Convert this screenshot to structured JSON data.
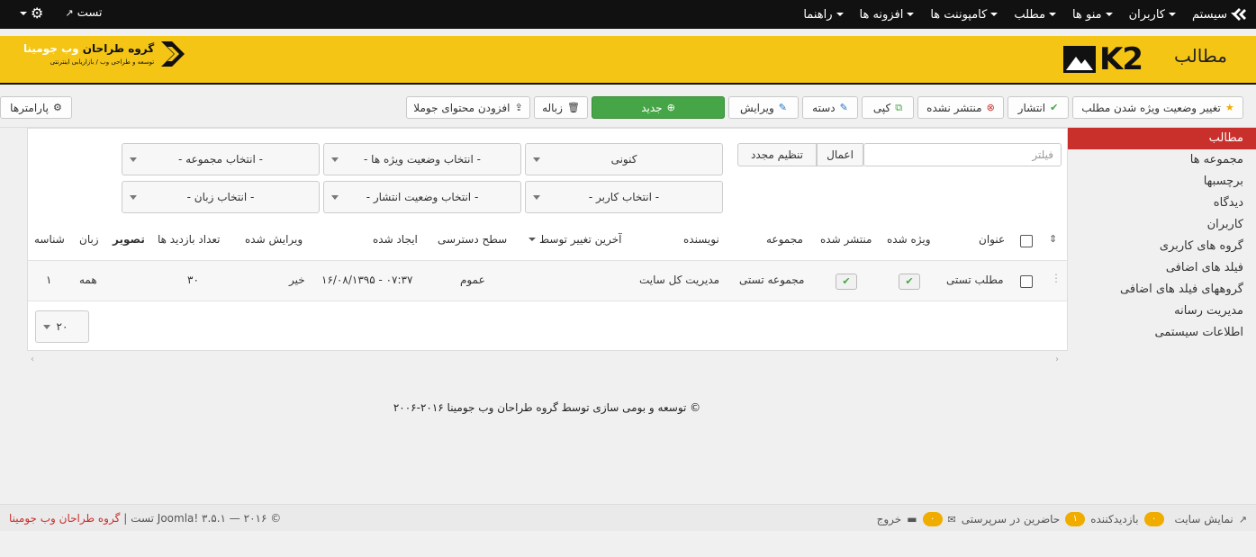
{
  "topbar": {
    "menu": [
      "سیستم",
      "کاربران",
      "منو ها",
      "مطلب",
      "کامپوننت ها",
      "افزونه ها",
      "راهنما"
    ],
    "site_link": "تست"
  },
  "header": {
    "title": "مطالب",
    "k2_logo": "K2",
    "brand_name_a": "گروه طراحان",
    "brand_name_b": "وب جومینا",
    "brand_sub": "توسعه و طراحی وب / بازاریابی اینترنتی"
  },
  "toolbar": {
    "featured_toggle": "تغییر وضعیت ویژه شدن مطلب",
    "publish": "انتشار",
    "unpublish": "منتشر نشده",
    "copy": "کپی",
    "batch": "دسته",
    "edit": "ویرایش",
    "new": "جدید",
    "trash": "زباله",
    "import": "افزودن محتوای جوملا",
    "options": "پارامترها"
  },
  "sidebar": {
    "items": [
      "مطالب",
      "مجموعه ها",
      "برچسبها",
      "دیدگاه",
      "کاربران",
      "گروه های کاربری",
      "فیلد های اضافی",
      "گروههای فیلد های اضافی",
      "مدیریت رسانه",
      "اطلاعات سیستمی"
    ]
  },
  "filters": {
    "search_placeholder": "فیلتر",
    "apply": "اعمال",
    "reset": "تنظیم مجدد",
    "state": "کنونی",
    "featured": "- انتخاب وضعیت ویژه ها -",
    "category": "- انتخاب مجموعه -",
    "author": "- انتخاب کاربر -",
    "published": "- انتخاب وضعیت انتشار -",
    "language": "- انتخاب زبان -"
  },
  "table": {
    "headers": {
      "title": "عنوان",
      "featured": "ویژه شده",
      "published": "منتشر شده",
      "category": "مجموعه",
      "author": "نویسنده",
      "modified_by": "آخرین تغییر توسط",
      "access": "سطح دسترسی",
      "created": "ایجاد شده",
      "modified": "ویرایش شده",
      "hits": "تعداد بازدید ها",
      "image": "تصویر",
      "language": "زبان",
      "id": "شناسه"
    },
    "rows": [
      {
        "title": "مطلب تستی",
        "category": "مجموعه تستی",
        "author": "مدیریت کل سایت",
        "access": "عموم",
        "created": "۱۶/۰۸/۱۳۹۵ - ۰۷:۳۷",
        "modified": "خیر",
        "hits": "۳۰",
        "language": "همه",
        "id": "۱"
      }
    ],
    "limit": "۲۰"
  },
  "footer": {
    "note": "توسعه و بومی سازی توسط گروه طراحان وب جومینا ۲۰۱۶-۲۰۰۶ ©"
  },
  "statusbar": {
    "view_site": "نمایش سایت",
    "visitors_count": "۰",
    "visitors_label": "بازدیدکننده",
    "admins_count": "۱",
    "admins_label": "حاضرین در سرپرستی",
    "messages_count": "۰",
    "logout": "خروج",
    "credit_brand": "گروه طراحان وب جومینا",
    "credit_rest": "| تست Joomla! ۳.۵.۱ — ۲۰۱۶ ©"
  },
  "colors": {
    "header_bg": "#f5c516",
    "topbar_bg": "#111111",
    "active_red": "#c9302c",
    "new_green": "#46a546",
    "badge_orange": "#f0ad00"
  }
}
